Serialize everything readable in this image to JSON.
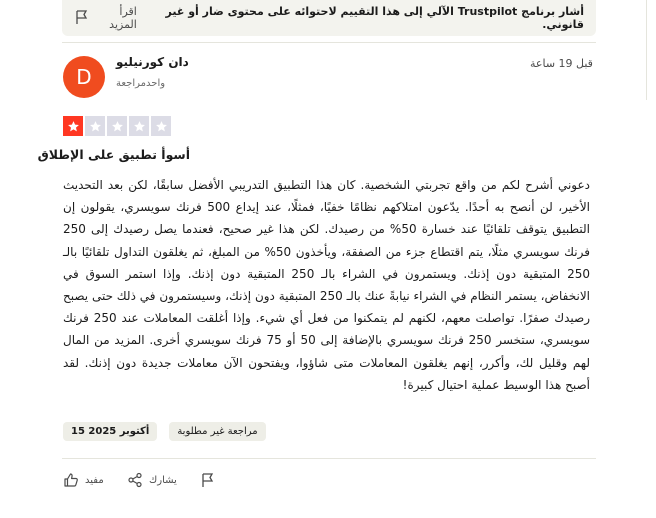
{
  "notice": {
    "text": "أشار برنامج Trustpilot الآلي إلى هذا التقييم لاحتوائه على محتوى ضار أو غير قانوني.",
    "read_more": "اقرأ المزيد"
  },
  "reviewer": {
    "initial": "D",
    "name": "دان كورنيليو",
    "review_count": "واحدمراجعة",
    "time_ago": "قبل 19 ساعة",
    "avatar_color": "#f04c1f"
  },
  "rating": {
    "value": 1,
    "max": 5,
    "filled_color": "#ff3722",
    "empty_color": "#dcdce6"
  },
  "review": {
    "title": "أسوأ تطبيق على الإطلاق",
    "body": "دعوني أشرح لكم من واقع تجربتي الشخصية. كان هذا التطبيق التدريبي الأفضل سابقًا، لكن بعد التحديث الأخير، لن أنصح به أحدًا. يدّعون امتلاكهم نظامًا خفيًا، فمثلًا، عند إيداع 500 فرنك سويسري، يقولون إن التطبيق يتوقف تلقائيًا عند خسارة 50% من رصيدك. لكن هذا غير صحيح، فعندما يصل رصيدك إلى 250 فرنك سويسري مثلًا، يتم اقتطاع جزء من الصفقة، ويأخذون 50% من المبلغ، ثم يغلقون التداول تلقائيًا بالـ 250 المتبقية دون إذنك. ويستمرون في الشراء بالـ 250 المتبقية دون إذنك. وإذا استمر السوق في الانخفاض، يستمر النظام في الشراء نيابةً عنك بالـ 250 المتبقية دون إذنك، وسيستمرون في ذلك حتى يصبح رصيدك صفرًا. تواصلت معهم، لكنهم لم يتمكنوا من فعل أي شيء. وإذا أغلقت المعاملات عند 250 فرنك سويسري، ستخسر 250 فرنك سويسري بالإضافة إلى 50 أو 75 فرنك سويسري أخرى. المزيد من المال لهم وقليل لك، وأكرر، إنهم يغلقون المعاملات متى شاؤوا، ويفتحون الآن معاملات جديدة دون إذنك. لقد أصبح هذا الوسيط عملية احتيال كبيرة!"
  },
  "tags": {
    "date": "15 أكتوبر 2025",
    "unsolicited": "مراجعة غير مطلوبة"
  },
  "actions": {
    "useful": "مفيد",
    "share": "يشارك",
    "useful_icon": "thumbs-up-icon",
    "share_icon": "share-icon",
    "flag_icon": "flag-icon"
  }
}
